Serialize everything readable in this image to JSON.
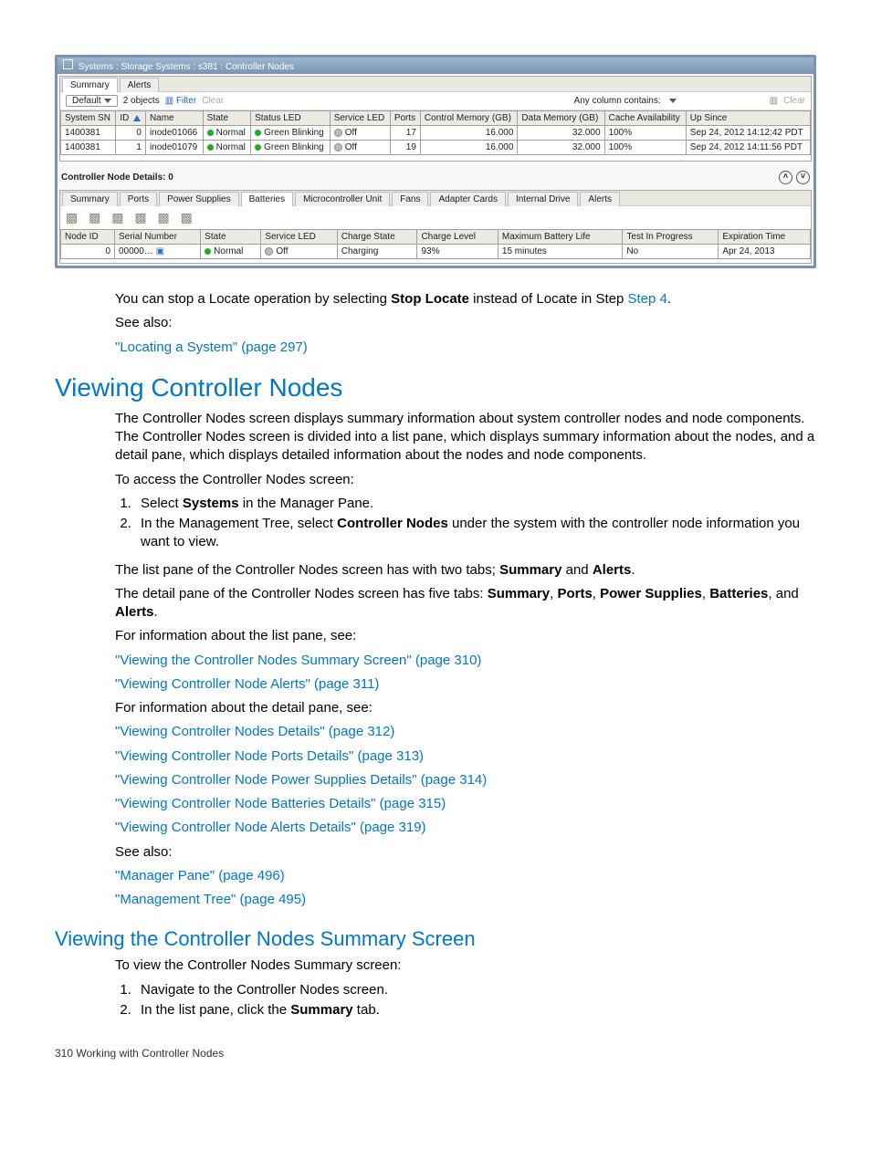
{
  "screenshot": {
    "breadcrumb": "Systems : Storage Systems : s381 : Controller Nodes",
    "listTabs": [
      "Summary",
      "Alerts"
    ],
    "toolbar": {
      "dropdown": "Default",
      "objects": "2 objects",
      "filter": "Filter",
      "clear": "Clear",
      "anyColumn": "Any column contains:",
      "clearRight": "Clear"
    },
    "listHeaders": [
      "System SN",
      "ID",
      "Name",
      "State",
      "Status LED",
      "Service LED",
      "Ports",
      "Control Memory (GB)",
      "Data Memory (GB)",
      "Cache Availability",
      "Up Since"
    ],
    "listRows": [
      {
        "sn": "1400381",
        "id": "0",
        "name": "inode01066",
        "state": "Normal",
        "status": "Green Blinking",
        "service": "Off",
        "ports": "17",
        "ctrl": "16.000",
        "data": "32.000",
        "cache": "100%",
        "up": "Sep 24, 2012 14:12:42 PDT"
      },
      {
        "sn": "1400381",
        "id": "1",
        "name": "inode01079",
        "state": "Normal",
        "status": "Green Blinking",
        "service": "Off",
        "ports": "19",
        "ctrl": "16.000",
        "data": "32.000",
        "cache": "100%",
        "up": "Sep 24, 2012 14:11:56 PDT"
      }
    ],
    "detailTitle": "Controller Node Details: 0",
    "detailTabs": [
      "Summary",
      "Ports",
      "Power Supplies",
      "Batteries",
      "Microcontroller Unit",
      "Fans",
      "Adapter Cards",
      "Internal Drive",
      "Alerts"
    ],
    "detailHeaders": [
      "Node ID",
      "Serial Number",
      "State",
      "Service LED",
      "Charge State",
      "Charge Level",
      "Maximum Battery Life",
      "Test In Progress",
      "Expiration Time"
    ],
    "detailRow": {
      "id": "0",
      "serial": "00000…",
      "state": "Normal",
      "service": "Off",
      "charge": "Charging",
      "level": "93%",
      "life": "15 minutes",
      "test": "No",
      "exp": "Apr 24, 2013"
    }
  },
  "text": {
    "p1a": "You can stop a Locate operation by selecting ",
    "p1b": "Stop Locate",
    "p1c": " instead of Locate in Step ",
    "p1d": "Step 4",
    "p1e": ".",
    "seeAlso": "See also:",
    "link1": "\"Locating a System\" (page 297)",
    "h1": "Viewing Controller Nodes",
    "p2": "The Controller Nodes screen displays summary information about system controller nodes and node components. The Controller Nodes screen is divided into a list pane, which displays summary information about the nodes, and a detail pane, which displays detailed information about the nodes and node components.",
    "p3": "To access the Controller Nodes screen:",
    "step1a": "Select ",
    "step1b": "Systems",
    "step1c": " in the Manager Pane.",
    "step2a": "In the Management Tree, select ",
    "step2b": "Controller Nodes",
    "step2c": " under the system with the controller node information you want to view.",
    "p4a": "The list pane of the Controller Nodes screen has with two tabs; ",
    "p4b": "Summary",
    "p4c": " and ",
    "p4d": "Alerts",
    "p4e": ".",
    "p5a": "The detail pane of the Controller Nodes screen has five tabs: ",
    "p5b": "Summary",
    "p5c": ", ",
    "p5d": "Ports",
    "p5e": ", ",
    "p5f": "Power Supplies",
    "p5g": ", ",
    "p5h": "Batteries",
    "p5i": ", and ",
    "p5j": "Alerts",
    "p5k": ".",
    "p6": "For information about the list pane, see:",
    "link2": "\"Viewing the Controller Nodes Summary Screen\" (page 310)",
    "link3": "\"Viewing Controller Node Alerts\" (page 311)",
    "p7": "For information about the detail pane, see:",
    "link4": "\"Viewing Controller Nodes Details\" (page 312)",
    "link5": "\"Viewing Controller Node Ports Details\" (page 313)",
    "link6": "\"Viewing Controller Node Power Supplies Details\" (page 314)",
    "link7": "\"Viewing Controller Node Batteries Details\" (page 315)",
    "link8": "\"Viewing Controller Node Alerts Details\" (page 319)",
    "link9": "\"Manager Pane\" (page 496)",
    "link10": "\"Management Tree\" (page 495)",
    "h2": "Viewing the Controller Nodes Summary Screen",
    "p8": "To view the Controller Nodes Summary screen:",
    "s2step1": "Navigate to the Controller Nodes screen.",
    "s2step2a": "In the list pane, click the ",
    "s2step2b": "Summary",
    "s2step2c": " tab.",
    "footer": "310   Working with Controller Nodes"
  }
}
